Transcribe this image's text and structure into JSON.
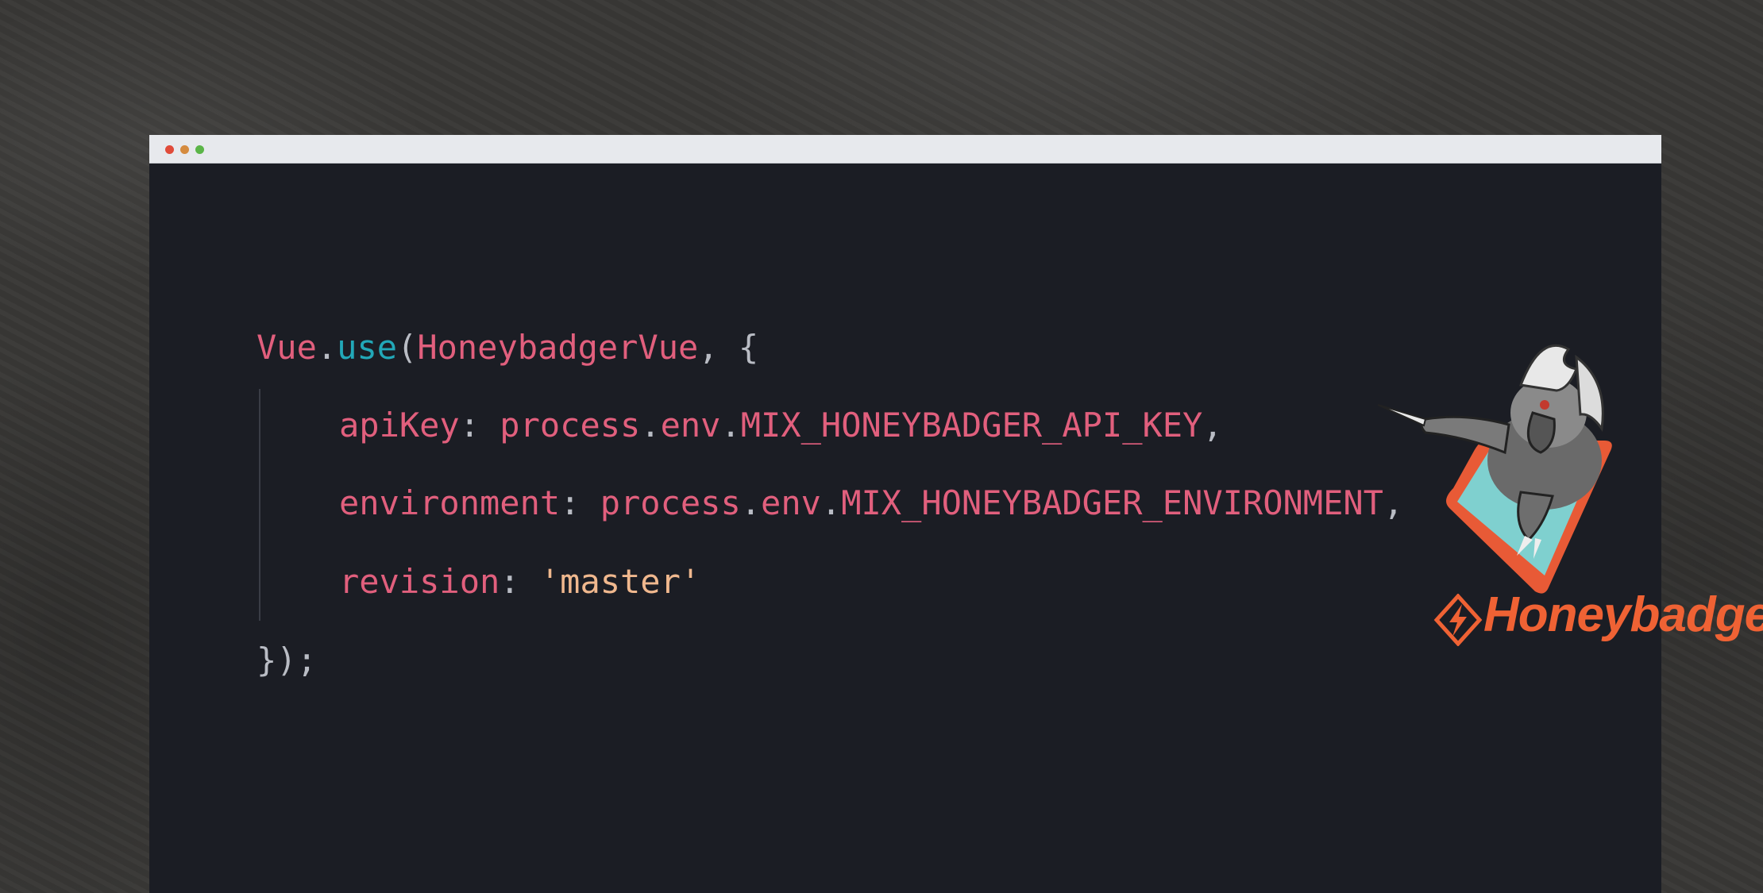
{
  "window": {
    "controls": [
      "close",
      "minimize",
      "maximize"
    ],
    "colors": {
      "close": "#e04b3a",
      "minimize": "#d58b3f",
      "maximize": "#5bb548"
    }
  },
  "code": {
    "line1": {
      "obj": "Vue",
      "dot": ".",
      "method": "use",
      "open": "(",
      "arg": "HoneybadgerVue",
      "comma": ", ",
      "brace": "{"
    },
    "line2": {
      "key": "apiKey",
      "colon": ": ",
      "p1": "process",
      "d1": ".",
      "p2": "env",
      "d2": ".",
      "p3": "MIX_HONEYBADGER_API_KEY",
      "comma": ","
    },
    "line3": {
      "key": "environment",
      "colon": ": ",
      "p1": "process",
      "d1": ".",
      "p2": "env",
      "d2": ".",
      "p3": "MIX_HONEYBADGER_ENVIRONMENT",
      "comma": ","
    },
    "line4": {
      "key": "revision",
      "colon": ": ",
      "value": "'master'"
    },
    "line5": {
      "close": "});"
    }
  },
  "brand": {
    "name": "Honeybadger",
    "logo_icon": "honeybadger-mascot-icon",
    "accent": "#ef6234"
  },
  "syntax_colors": {
    "identifier": "#e15f7d",
    "function": "#22a8b8",
    "string": "#f0b88e",
    "punctuation": "#b9bcc4"
  }
}
